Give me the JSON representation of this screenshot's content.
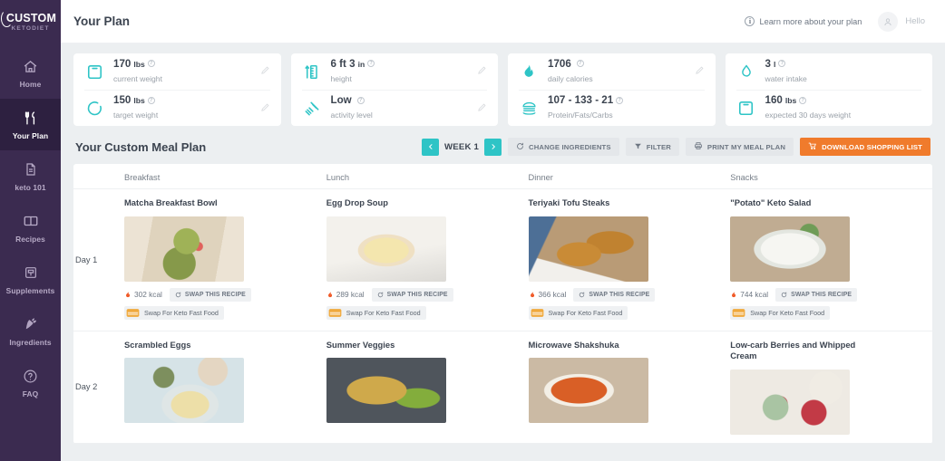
{
  "brand": {
    "name": "CUSTOM",
    "tagline": "KETODIET"
  },
  "sidebar": {
    "items": [
      {
        "label": "Home",
        "icon": "home-icon",
        "active": false
      },
      {
        "label": "Your Plan",
        "icon": "cutlery-icon",
        "active": true
      },
      {
        "label": "keto 101",
        "icon": "document-icon",
        "active": false
      },
      {
        "label": "Recipes",
        "icon": "book-icon",
        "active": false
      },
      {
        "label": "Supplements",
        "icon": "supplement-jar-icon",
        "active": false
      },
      {
        "label": "Ingredients",
        "icon": "carrot-icon",
        "active": false
      },
      {
        "label": "FAQ",
        "icon": "question-circle-icon",
        "active": false
      }
    ]
  },
  "header": {
    "title": "Your Plan",
    "learn_more": "Learn more about your plan",
    "info_glyph": "i",
    "greeting": "Hello"
  },
  "stats": [
    {
      "rows": [
        {
          "value": "170",
          "unit": "lbs",
          "label": "current weight",
          "icon": "scale-icon",
          "editable": true
        },
        {
          "value": "150",
          "unit": "lbs",
          "label": "target weight",
          "icon": "target-ring-icon",
          "editable": true
        }
      ]
    },
    {
      "rows": [
        {
          "value": "6 ft 3",
          "unit": "in",
          "label": "height",
          "icon": "ruler-icon",
          "editable": true
        },
        {
          "value": "Low",
          "unit": "",
          "label": "activity level",
          "icon": "dumbbell-icon",
          "editable": true
        }
      ]
    },
    {
      "rows": [
        {
          "value": "1706",
          "unit": "",
          "label": "daily calories",
          "icon": "flame-icon",
          "editable": true
        },
        {
          "value": "107 - 133 - 21",
          "unit": "",
          "label": "Protein/Fats/Carbs",
          "icon": "burger-icon",
          "editable": false
        }
      ]
    },
    {
      "rows": [
        {
          "value": "3",
          "unit": "l",
          "label": "water intake",
          "icon": "water-drop-icon",
          "editable": false
        },
        {
          "value": "160",
          "unit": "lbs",
          "label": "expected 30 days weight",
          "icon": "scale-icon",
          "editable": false
        }
      ]
    }
  ],
  "meal_plan": {
    "title": "Your Custom Meal Plan",
    "week_label": "WEEK 1",
    "prev_label": "‹",
    "next_label": "›",
    "buttons": {
      "change_ingredients": "CHANGE INGREDIENTS",
      "filter": "FILTER",
      "print": "PRINT MY MEAL PLAN",
      "download": "DOWNLOAD SHOPPING LIST"
    },
    "accent_teal": "#2ec4c6",
    "accent_orange": "#f07b2c",
    "columns": [
      "Breakfast",
      "Lunch",
      "Dinner",
      "Snacks"
    ],
    "swap_recipe_label": "SWAP THIS RECIPE",
    "fast_food_label": "Swap For Keto Fast Food",
    "days": [
      {
        "day": "Day 1",
        "meals": [
          {
            "title": "Matcha Breakfast Bowl",
            "kcal": "302 kcal",
            "img_a": "#d9ceba",
            "img_b": "#8fa152",
            "img_c": "#e8dfd0"
          },
          {
            "title": "Egg Drop Soup",
            "kcal": "289 kcal",
            "img_a": "#e7d7a8",
            "img_b": "#f0e3bd",
            "img_c": "#cfcfcf"
          },
          {
            "title": "Teriyaki Tofu Steaks",
            "kcal": "366 kcal",
            "img_a": "#c18a3e",
            "img_b": "#8a6b3d",
            "img_c": "#e3ddd4"
          },
          {
            "title": "\"Potato\" Keto Salad",
            "kcal": "744 kcal",
            "img_a": "#e8e6de",
            "img_b": "#cfd4c2",
            "img_c": "#b9a78e"
          }
        ]
      },
      {
        "day": "Day 2",
        "meals": [
          {
            "title": "Scrambled Eggs",
            "kcal": "",
            "img_a": "#cfdde2",
            "img_b": "#e9d79a",
            "img_c": "#d3c2a8"
          },
          {
            "title": "Summer Veggies",
            "kcal": "",
            "img_a": "#c9a84c",
            "img_b": "#7fa33a",
            "img_c": "#4a4d52"
          },
          {
            "title": "Microwave Shakshuka",
            "kcal": "",
            "img_a": "#d8612a",
            "img_b": "#f2ead6",
            "img_c": "#c9b9a3"
          },
          {
            "title": "Low-carb Berries and Whipped Cream",
            "kcal": "",
            "img_a": "#ebe6df",
            "img_b": "#c23a46",
            "img_c": "#a7c1a4"
          }
        ]
      }
    ]
  }
}
